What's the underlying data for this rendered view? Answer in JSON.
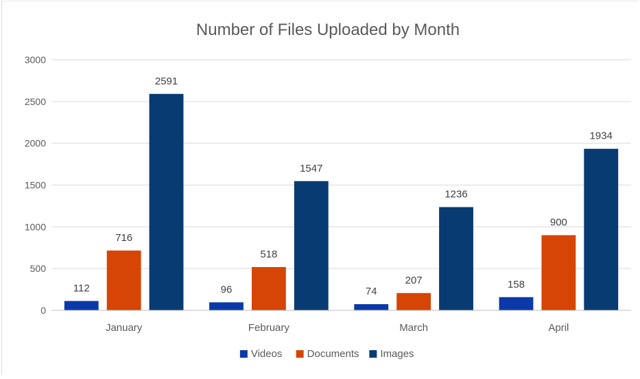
{
  "chart_data": {
    "type": "bar",
    "title": "Number of Files Uploaded by Month",
    "categories": [
      "January",
      "February",
      "March",
      "April"
    ],
    "series": [
      {
        "name": "Videos",
        "color": "#0b3aa8",
        "values": [
          112,
          96,
          74,
          158
        ]
      },
      {
        "name": "Documents",
        "color": "#d64505",
        "values": [
          716,
          518,
          207,
          900
        ]
      },
      {
        "name": "Images",
        "color": "#083b72",
        "values": [
          2591,
          1547,
          1236,
          1934
        ]
      }
    ],
    "ylim": [
      0,
      3000
    ],
    "yticks": [
      "0",
      "500",
      "1000",
      "1500",
      "2000",
      "2500",
      "3000"
    ],
    "grid": true,
    "legend_position": "bottom",
    "xlabel": "",
    "ylabel": ""
  }
}
